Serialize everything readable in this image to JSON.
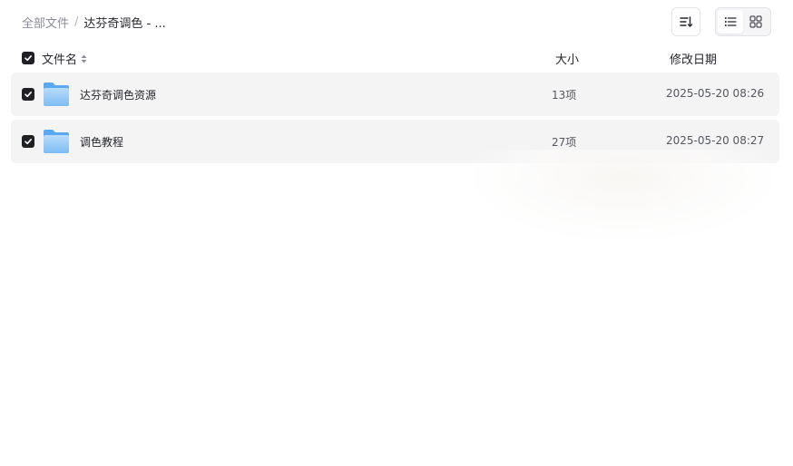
{
  "breadcrumb": {
    "root": "全部文件",
    "separator": "/",
    "current": "达芬奇调色 - ..."
  },
  "toolbar": {
    "sort_icon": "sort-list-icon",
    "view_list_icon": "list-view-icon",
    "view_grid_icon": "grid-view-icon",
    "active_view": "list"
  },
  "table": {
    "columns": {
      "name": "文件名",
      "size": "大小",
      "date": "修改日期"
    },
    "rows": [
      {
        "name": "达芬奇调色资源",
        "count": "13项",
        "date": "2025-05-20 08:26",
        "checked": true,
        "icon": "folder-icon"
      },
      {
        "name": "调色教程",
        "count": "27项",
        "date": "2025-05-20 08:27",
        "checked": true,
        "icon": "folder-icon"
      }
    ]
  },
  "colors": {
    "row_bg": "#f4f4f5",
    "checkbox": "#1f2024",
    "folder_light": "#a9d3f8",
    "folder_dark": "#5aa8ef"
  }
}
